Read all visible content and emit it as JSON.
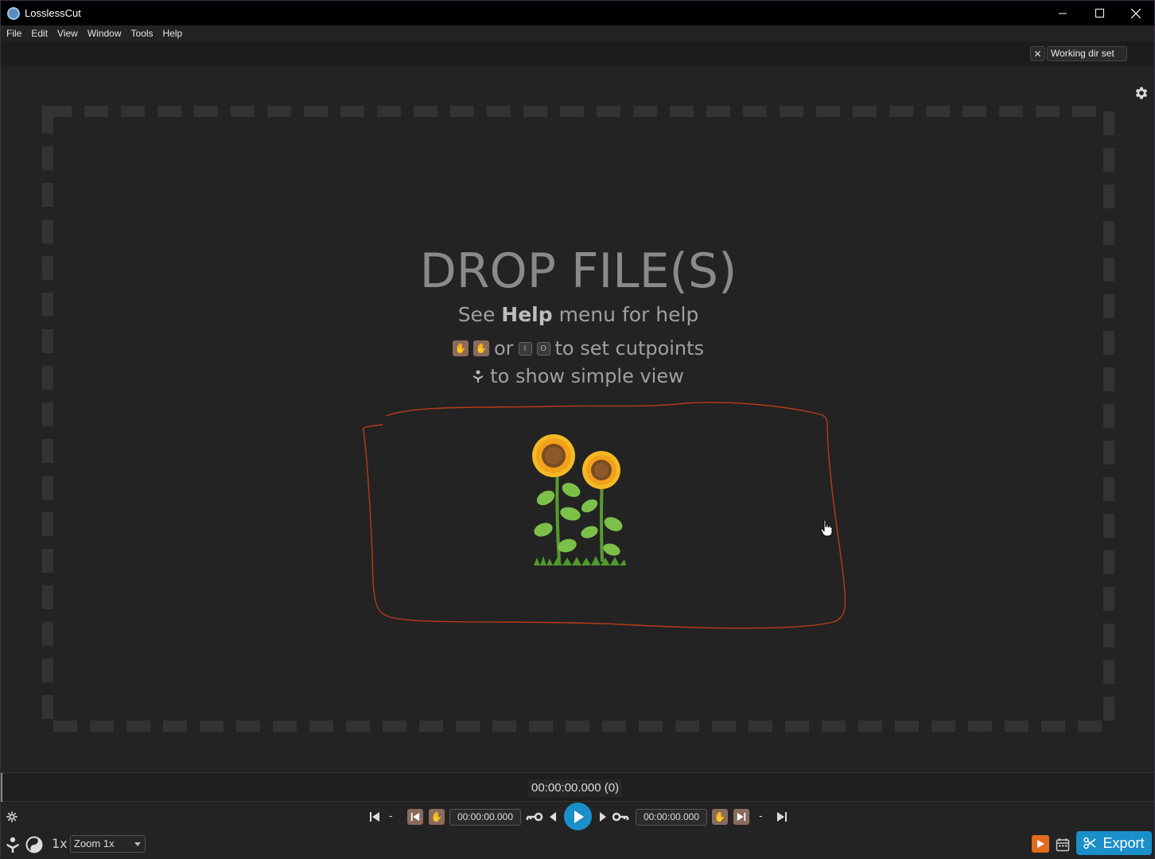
{
  "window": {
    "title": "LosslessCut",
    "controls": [
      "minimize",
      "maximize",
      "close"
    ]
  },
  "menu": [
    "File",
    "Edit",
    "View",
    "Window",
    "Tools",
    "Help"
  ],
  "topbar": {
    "working_dir_label": "Working dir set",
    "close_symbol": "✕"
  },
  "dropzone": {
    "title": "DROP FILE(S)",
    "help_prefix": "See",
    "help_bold": "Help",
    "help_suffix": "menu for help",
    "cut_or": "or",
    "cut_key_in": "I",
    "cut_key_out": "O",
    "cut_suffix": "to set cutpoints",
    "simple_suffix": "to show simple view"
  },
  "annotation": {
    "stroke_color": "#b83c1a"
  },
  "timeline": {
    "timecode": "00:00:00.000 (0)"
  },
  "controls": {
    "dash_left": "-",
    "dash_right": "-",
    "start_time": "00:00:00.000",
    "end_time": "00:00:00.000"
  },
  "bottom": {
    "speed": "1x",
    "zoom": "Zoom 1x",
    "export_label": "Export"
  },
  "colors": {
    "accent": "#1a8fc9",
    "orange": "#e36b1f",
    "cutpoint": "#8a6b5c"
  }
}
